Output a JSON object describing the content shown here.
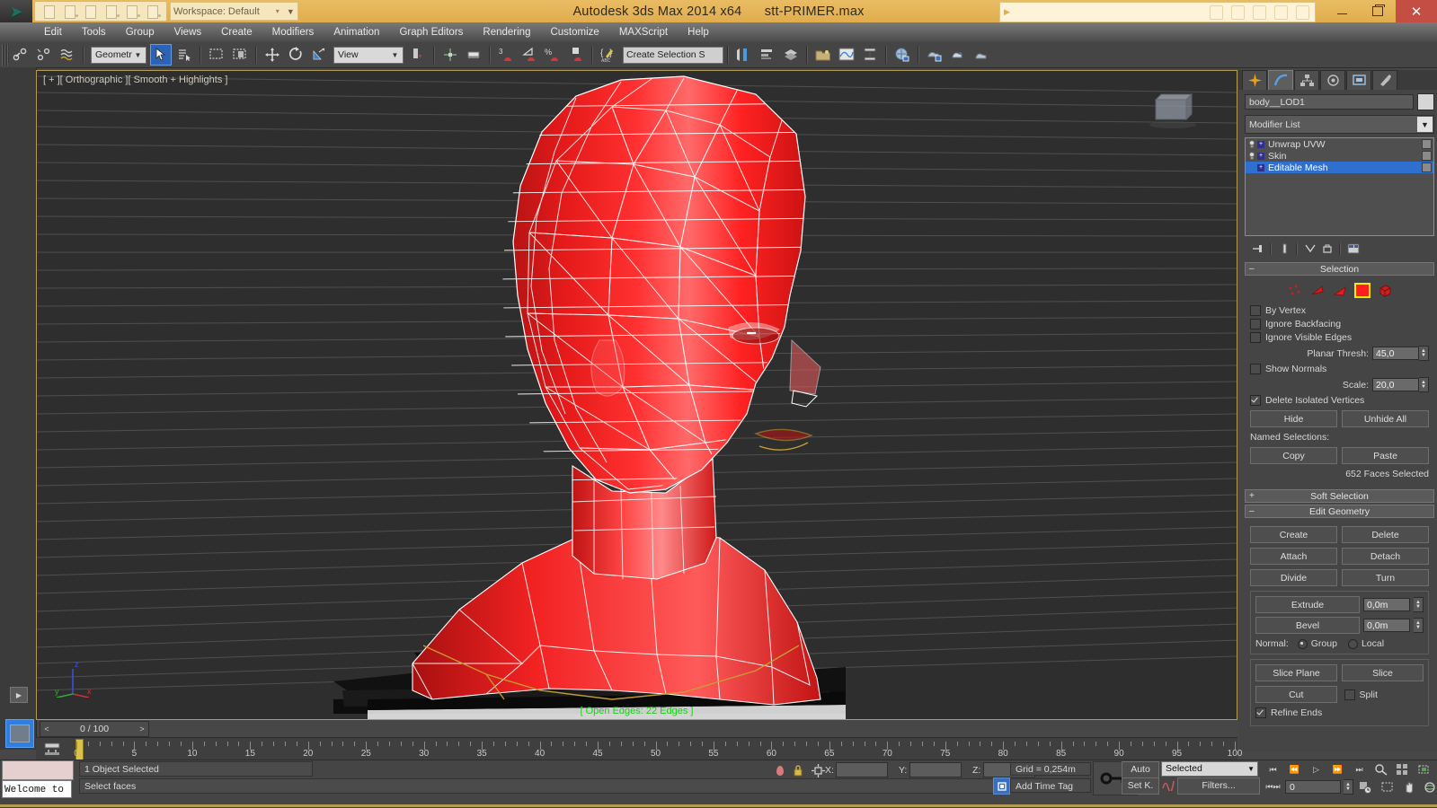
{
  "window": {
    "title_app": "Autodesk 3ds Max  2014 x64",
    "title_file": "stt-PRIMER.max",
    "workspace_label": "Workspace: Default",
    "minimize": "–",
    "restore": "❐",
    "close": "✕"
  },
  "menu": {
    "items": [
      "Edit",
      "Tools",
      "Group",
      "Views",
      "Create",
      "Modifiers",
      "Animation",
      "Graph Editors",
      "Rendering",
      "Customize",
      "MAXScript",
      "Help"
    ]
  },
  "toolbar": {
    "selection_filter": "Geometr",
    "reference_coord": "View",
    "named_selection_sets": "Create Selection S",
    "icons": [
      "undo-icon",
      "redo-icon",
      "select-link-icon",
      "unlink-icon",
      "bind-space-warp-icon",
      "select-object-icon",
      "select-by-name-icon",
      "rectangular-region-icon",
      "window-crossing-icon",
      "select-move-icon",
      "select-rotate-icon",
      "select-scale-icon",
      "use-pivot-center-icon",
      "select-manipulate-icon",
      "snap-toggle-icon",
      "angle-snap-icon",
      "percent-snap-icon",
      "spinner-snap-icon",
      "edit-named-selections-icon",
      "mirror-icon",
      "align-icon",
      "layer-manager-icon",
      "graph-editors-icon",
      "curve-editor-icon",
      "schematic-view-icon",
      "material-editor-icon",
      "render-setup-icon",
      "rendered-frame-icon",
      "render-production-icon"
    ]
  },
  "viewport": {
    "label": "[ + ][ Orthographic ][ Smooth + Highlights ]",
    "status_text": "[ Open Edges: 22 Edges ]",
    "axis_x": "x",
    "axis_y": "y",
    "axis_z": "z",
    "background_color": "#2e2e2e",
    "mesh_color": "#ff1a1a",
    "wire_color": "#ffffff",
    "border_color": "#b39b4f"
  },
  "command_panel": {
    "tabs": [
      "create-tab",
      "modify-tab",
      "hierarchy-tab",
      "motion-tab",
      "display-tab",
      "utilities-tab"
    ],
    "active_tab_index": 1,
    "object_name": "body__LOD1",
    "modifier_list_label": "Modifier List",
    "modifier_stack": [
      {
        "name": "Unwrap UVW",
        "selected": false,
        "has_bulb": true
      },
      {
        "name": "Skin",
        "selected": false,
        "has_bulb": true
      },
      {
        "name": "Editable Mesh",
        "selected": true,
        "has_bulb": false
      }
    ],
    "stack_tools": [
      "pin-stack-icon",
      "show-end-result-icon",
      "make-unique-icon",
      "remove-modifier-icon",
      "configure-modifier-sets-icon"
    ],
    "rollouts": {
      "selection": {
        "title": "Selection",
        "expanded": true,
        "subobject_levels": [
          "vertex-icon",
          "edge-icon",
          "face-icon",
          "polygon-icon",
          "element-icon"
        ],
        "active_subobject_index": 3,
        "checkboxes": [
          {
            "label": "By Vertex",
            "checked": false
          },
          {
            "label": "Ignore Backfacing",
            "checked": false
          },
          {
            "label": "Ignore Visible Edges",
            "checked": false
          },
          {
            "label": "Show Normals",
            "checked": false
          },
          {
            "label": "Delete Isolated Vertices",
            "checked": true
          }
        ],
        "planar_thresh_label": "Planar Thresh:",
        "planar_thresh_value": "45,0",
        "scale_label": "Scale:",
        "scale_value": "20,0",
        "hide_button": "Hide",
        "unhide_button": "Unhide All",
        "named_selections_label": "Named Selections:",
        "copy_button": "Copy",
        "paste_button": "Paste",
        "faces_selected": "652 Faces Selected"
      },
      "soft_selection": {
        "title": "Soft Selection",
        "expanded": false
      },
      "edit_geometry": {
        "title": "Edit Geometry",
        "expanded": true,
        "create_button": "Create",
        "delete_button": "Delete",
        "attach_button": "Attach",
        "detach_button": "Detach",
        "divide_button": "Divide",
        "turn_button": "Turn",
        "extrude_button": "Extrude",
        "extrude_value": "0,0m",
        "bevel_button": "Bevel",
        "bevel_value": "0,0m",
        "normal_label": "Normal:",
        "normal_group": "Group",
        "normal_local": "Local",
        "normal_selected": "Group",
        "slice_plane_button": "Slice Plane",
        "slice_button": "Slice",
        "cut_button": "Cut",
        "split_label": "Split",
        "split_checked": false,
        "refine_ends_label": "Refine Ends",
        "refine_ends_checked": true
      }
    }
  },
  "time_slider": {
    "prev_arrow": "<",
    "value": "0 / 100",
    "next_arrow": ">"
  },
  "track_bar": {
    "tick_labels": [
      0,
      5,
      10,
      15,
      20,
      25,
      30,
      35,
      40,
      45,
      50,
      55,
      60,
      65,
      70,
      75,
      80,
      85,
      90,
      95,
      100
    ],
    "range_start": 0,
    "range_end": 100
  },
  "status_bar": {
    "maxscript_mini_listener": "Welcome to",
    "prompt_top": "1 Object Selected",
    "prompt_bottom": "Select faces",
    "x_label": "X:",
    "y_label": "Y:",
    "z_label": "Z:",
    "x_value": "",
    "y_value": "",
    "z_value": "",
    "grid_text": "Grid = 0,254m",
    "add_time_tag": "Add Time Tag",
    "auto_key": "Auto",
    "set_key": "Set K.",
    "key_filter_selected": "Selected",
    "filters_button": "Filters...",
    "frame_field": "0",
    "playback_icons": [
      "go-to-start-icon",
      "prev-frame-icon",
      "play-icon",
      "next-frame-icon",
      "go-to-end-icon",
      "key-mode-icon"
    ],
    "nav_icons": [
      "zoom-icon",
      "zoom-all-icon",
      "zoom-extents-icon",
      "zoom-extents-all-icon",
      "field-of-view-icon",
      "region-zoom-icon",
      "pan-icon",
      "orbit-icon",
      "maximize-viewport-icon"
    ]
  }
}
